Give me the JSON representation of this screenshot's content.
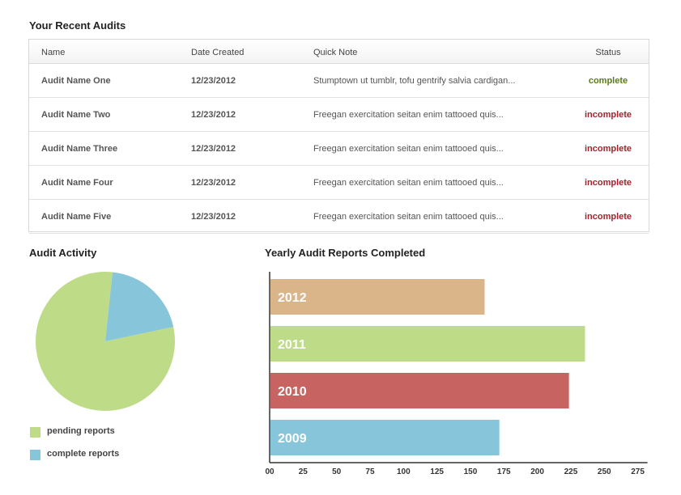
{
  "recent_audits": {
    "title": "Your Recent Audits",
    "columns": {
      "name": "Name",
      "date": "Date Created",
      "note": "Quick Note",
      "status": "Status"
    },
    "rows": [
      {
        "name": "Audit Name One",
        "date": "12/23/2012",
        "note": "Stumptown ut tumblr, tofu gentrify salvia cardigan...",
        "status": "complete"
      },
      {
        "name": "Audit Name Two",
        "date": "12/23/2012",
        "note": "Freegan exercitation seitan enim tattooed quis...",
        "status": "incomplete"
      },
      {
        "name": "Audit Name Three",
        "date": "12/23/2012",
        "note": "Freegan exercitation seitan enim tattooed quis...",
        "status": "incomplete"
      },
      {
        "name": "Audit Name Four",
        "date": "12/23/2012",
        "note": "Freegan exercitation seitan enim tattooed quis...",
        "status": "incomplete"
      },
      {
        "name": "Audit Name Five",
        "date": "12/23/2012",
        "note": "Freegan exercitation seitan enim tattooed quis...",
        "status": "incomplete"
      }
    ],
    "status_colors": {
      "complete": "#5b7a1c",
      "incomplete": "#a3232b"
    }
  },
  "audit_activity": {
    "title": "Audit Activity",
    "legend": [
      {
        "label": "pending reports",
        "color": "#bedc87"
      },
      {
        "label": "complete reports",
        "color": "#87c5da"
      }
    ]
  },
  "yearly_reports": {
    "title": "Yearly Audit Reports Completed"
  },
  "chart_data": [
    {
      "type": "pie",
      "title": "Audit Activity",
      "labels": [
        "pending reports",
        "complete reports"
      ],
      "values": [
        80,
        20
      ],
      "colors": [
        "#bedc87",
        "#87c5da"
      ]
    },
    {
      "type": "bar",
      "orientation": "horizontal",
      "title": "Yearly Audit Reports Completed",
      "categories": [
        "2012",
        "2011",
        "2010",
        "2009"
      ],
      "values": [
        160,
        235,
        223,
        171
      ],
      "colors": [
        "#d9b589",
        "#bedc87",
        "#c76462",
        "#87c5da"
      ],
      "xlim": [
        0,
        275
      ],
      "ticks": [
        0,
        25,
        50,
        75,
        100,
        125,
        150,
        175,
        200,
        225,
        250,
        275
      ],
      "tick_labels": [
        "00",
        "25",
        "50",
        "75",
        "100",
        "125",
        "150",
        "175",
        "200",
        "225",
        "250",
        "275"
      ]
    }
  ]
}
